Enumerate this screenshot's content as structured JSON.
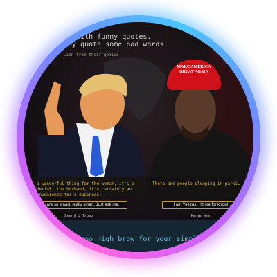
{
  "intro": {
    "line1": "…n with funny quotes.",
    "line2": "…ay quote some bad words.",
    "line3": "…ion from their genius"
  },
  "left_card": {
    "quote": "…s a wonderful thing for the woman, it's a wonderful… the husband, it's certainly an inconvenience for a business.",
    "button_label": "are so smart, really smart. Just ask me.",
    "signature": "Donald J Trump"
  },
  "right_card": {
    "quote": "There are people sleeping in parki…",
    "button_label": "I am Yeezus. Hit me for knowl…",
    "signature": "Kanye West"
  },
  "cap_text": "MAKE AMERICA GREAT AGAIN",
  "footer": "…too high brow for your simple s…",
  "colors": {
    "ring_pink": "#ff66e0",
    "ring_blue": "#4cc6ff",
    "quote_gold": "#e0b84a",
    "button_border": "#c79b35",
    "cap_red": "#d0101b"
  }
}
